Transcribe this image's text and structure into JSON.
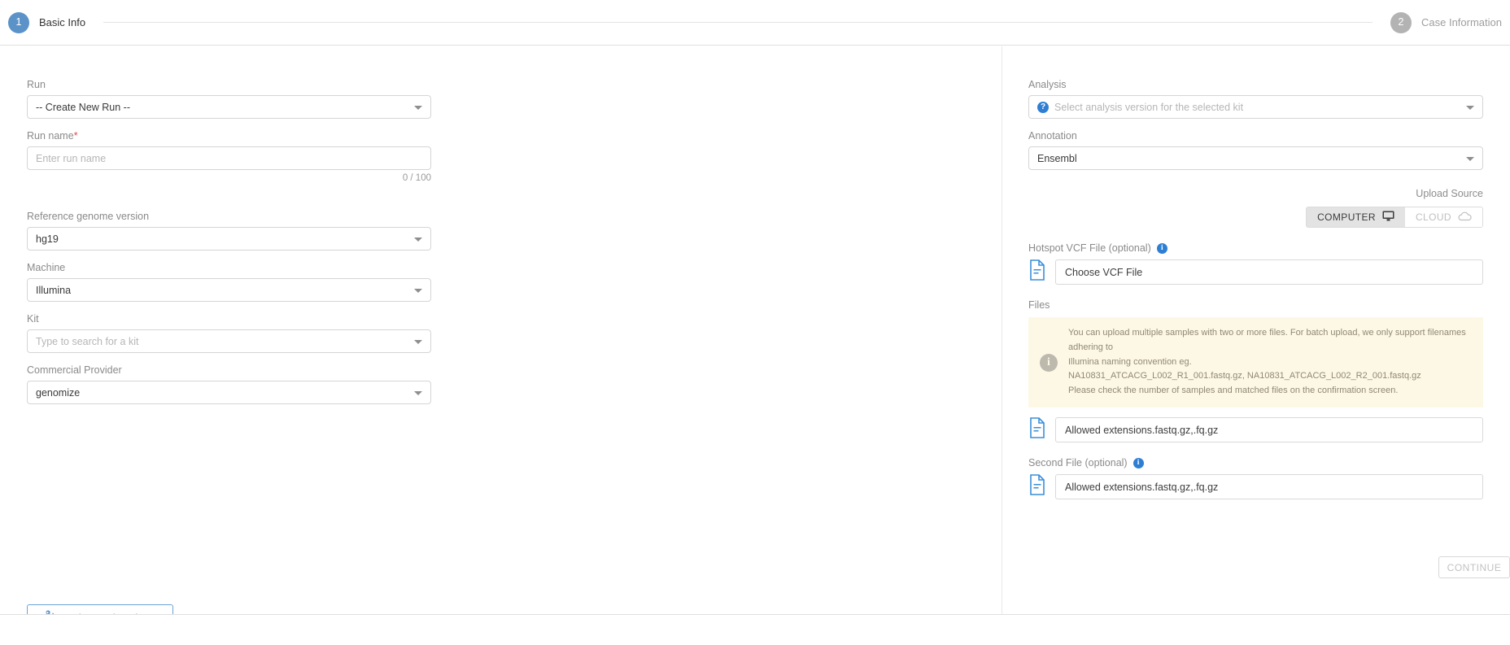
{
  "stepper": {
    "step1": {
      "number": "1",
      "label": "Basic Info"
    },
    "step2": {
      "number": "2",
      "label": "Case Information"
    }
  },
  "left": {
    "run": {
      "label": "Run",
      "value": "-- Create New Run --"
    },
    "run_name": {
      "label": "Run name",
      "required_mark": "*",
      "placeholder": "Enter run name",
      "counter": "0 / 100"
    },
    "reference_genome": {
      "label": "Reference genome version",
      "value": "hg19"
    },
    "machine": {
      "label": "Machine",
      "value": "Illumina"
    },
    "kit": {
      "label": "Kit",
      "placeholder": "Type to search for a kit"
    },
    "commercial_provider": {
      "label": "Commercial Provider",
      "value": "genomize"
    },
    "advanced_options_label": "Advanced Options"
  },
  "right": {
    "analysis": {
      "label": "Analysis",
      "placeholder": "Select analysis version for the selected kit",
      "icon_glyph": "?"
    },
    "annotation": {
      "label": "Annotation",
      "value": "Ensembl"
    },
    "upload_source": {
      "title": "Upload Source",
      "computer_label": "COMPUTER",
      "cloud_label": "CLOUD"
    },
    "hotspot": {
      "label": "Hotspot VCF File (optional)",
      "info_glyph": "i",
      "value": "Choose VCF File"
    },
    "files": {
      "label": "Files",
      "alert_glyph": "i",
      "alert_line1": "You can upload multiple samples with two or more files. For batch upload, we only support filenames adhering to",
      "alert_line2": "Illumina naming convention eg.",
      "alert_line3": "NA10831_ATCACG_L002_R1_001.fastq.gz, NA10831_ATCACG_L002_R2_001.fastq.gz",
      "alert_line4": "Please check the number of samples and matched files on the confirmation screen.",
      "value": "Allowed extensions.fastq.gz,.fq.gz"
    },
    "second_file": {
      "label": "Second File (optional)",
      "info_glyph": "i",
      "value": "Allowed extensions.fastq.gz,.fq.gz"
    }
  },
  "footer": {
    "continue_label": "CONTINUE"
  },
  "colors": {
    "accent_blue": "#5b93c9",
    "info_blue": "#2e7fd4",
    "alert_bg": "#fdf8e6",
    "required_red": "#e04a4a",
    "inactive_gray": "#b3b3b3"
  }
}
